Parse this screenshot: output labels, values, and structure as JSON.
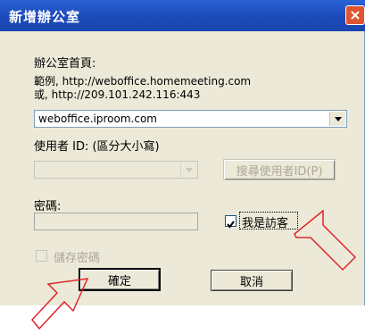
{
  "dialog": {
    "title": "新增辦公室",
    "homepage_label": "辦公室首頁:",
    "example_line1": "範例, http://weboffice.homemeeting.com",
    "example_line2": "或, http://209.101.242.116:443",
    "homepage_value": "weboffice.iproom.com",
    "userid_label": "使用者 ID: (區分大小寫)",
    "userid_value": "",
    "search_button": "搜尋使用者ID(P)",
    "password_label": "密碼:",
    "guest_checkbox": "我是訪客",
    "guest_checked": true,
    "save_password": "儲存密碼",
    "save_password_checked": false,
    "ok_button": "確定",
    "cancel_button": "取消"
  },
  "colors": {
    "titlebar": "#1c4bbb",
    "arrow_outline": "#e0242a",
    "close": "#e0552f"
  }
}
